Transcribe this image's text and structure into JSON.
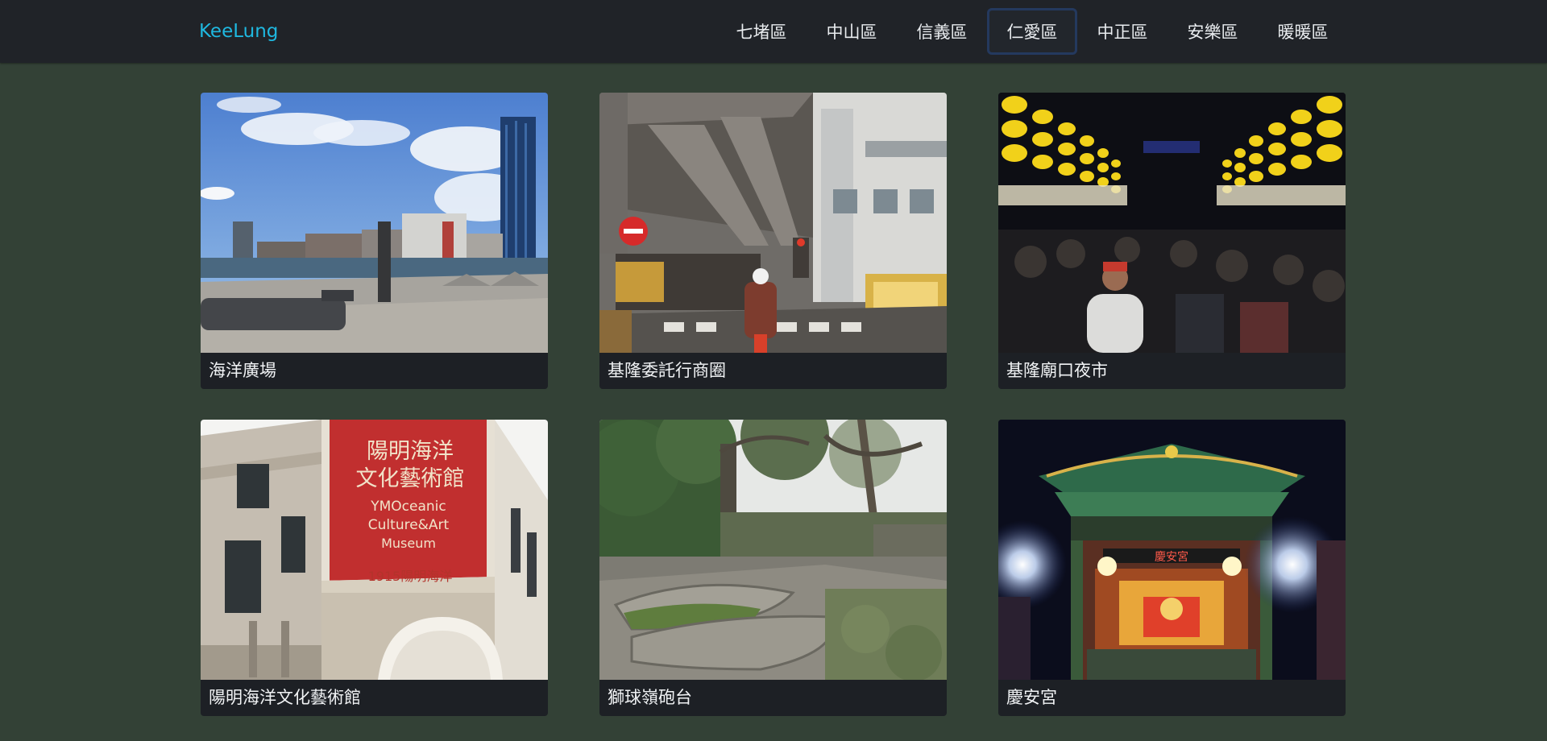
{
  "brand": "KeeLung",
  "nav": {
    "items": [
      "七堵區",
      "中山區",
      "信義區",
      "仁愛區",
      "中正區",
      "安樂區",
      "暖暖區"
    ],
    "active_index": 3
  },
  "cards": [
    {
      "title": "海洋廣場"
    },
    {
      "title": "基隆委託行商圈"
    },
    {
      "title": "基隆廟口夜市"
    },
    {
      "title": "陽明海洋文化藝術館",
      "sign_text": [
        "陽明海洋",
        "文化藝術館",
        "YMOceanic",
        "Culture&Art",
        "Museum",
        "1915陽明海洋"
      ]
    },
    {
      "title": "獅球嶺砲台"
    },
    {
      "title": "慶安宮",
      "sign_text": [
        "慶安宮"
      ]
    }
  ],
  "colors": {
    "page_bg": "#334136",
    "navbar_bg": "#202328",
    "brand": "#1fb8e0",
    "active_border": "#24395e",
    "caption_bg": "#1d2025"
  }
}
